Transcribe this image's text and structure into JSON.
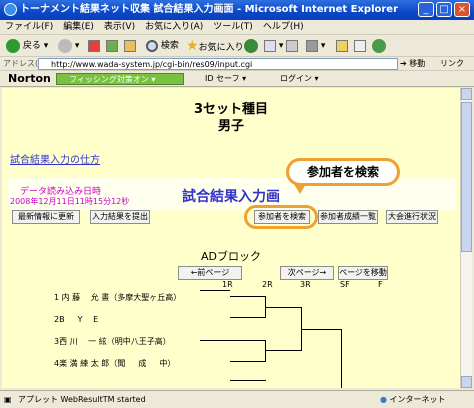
{
  "window": {
    "title": "トーナメント結果ネット収集 試合結果入力画面 - Microsoft Internet Explorer"
  },
  "menu": [
    "ファイル(F)",
    "編集(E)",
    "表示(V)",
    "お気に入り(A)",
    "ツール(T)",
    "ヘルプ(H)"
  ],
  "toolbar": {
    "back": "戻る",
    "search": "検索",
    "favorites": "お気に入り"
  },
  "address": {
    "label": "アドレス(D)",
    "url": "http://www.wada-system.jp/cgi-bin/res09/input.cgi",
    "go": "移動",
    "links": "リンク"
  },
  "norton": {
    "brand": "Norton",
    "phishing": "フィッシング対策オン",
    "id": "ID セーフ",
    "login": "ログイン"
  },
  "page": {
    "heading1": "3セット種目",
    "heading2": "男子",
    "link": "試合結果入力の仕方",
    "load_label": "データ読み込み日時",
    "load_time": "2008年12月11日11時15分12秒",
    "main_title": "試合結果入力画",
    "buttons": {
      "refresh": "最新情報に更新",
      "submit": "入力結果を提出",
      "search": "参加者を検索",
      "results": "参加者成績一覧",
      "progress": "大会進行状況"
    },
    "block_title": "ADブロック",
    "nav": {
      "prev": "←前ページ",
      "next": "次ページ→",
      "move": "ページを移動"
    },
    "rounds": [
      "1R",
      "2R",
      "3R",
      "SF",
      "F"
    ],
    "players": [
      {
        "no": "1",
        "name": "内 藤 　允 晝（多摩大聖ヶ丘高）"
      },
      {
        "no": "2",
        "name": "B 　 Y 　E"
      },
      {
        "no": "3",
        "name": "西 川 　一 絃（明中八王子高）"
      },
      {
        "no": "4",
        "name": "楽 満 練 太 郎（聞 　 成 　 中）"
      }
    ]
  },
  "callout": "参加者を検索",
  "status": {
    "left": "アプレット WebResultTM started",
    "right": "インターネット"
  }
}
